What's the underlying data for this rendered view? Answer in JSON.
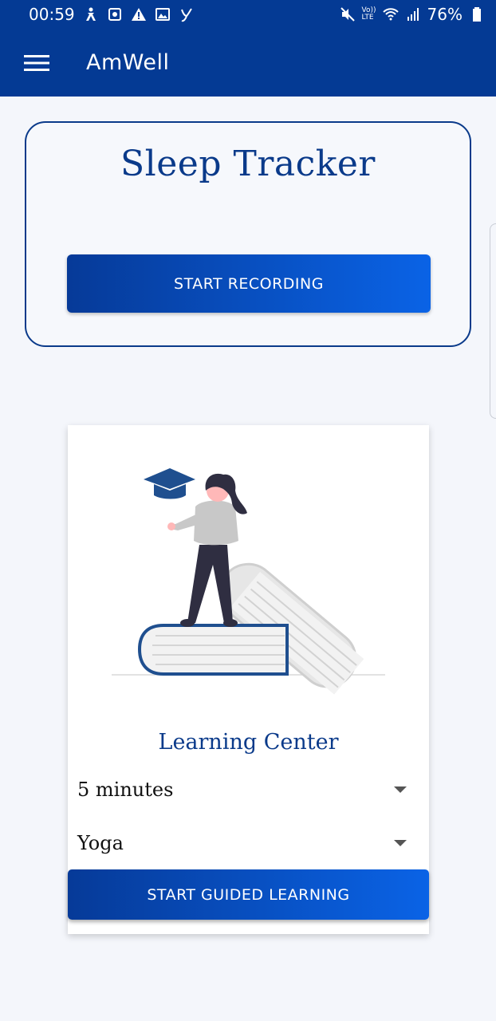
{
  "status_bar": {
    "time": "00:59",
    "battery": "76%",
    "lte_label_top": "Vo))",
    "lte_label_bottom": "LTE"
  },
  "app_bar": {
    "title": "AmWell",
    "menu_icon": "hamburger-menu-icon"
  },
  "sleep_tracker": {
    "title": "Sleep Tracker",
    "button_label": "START RECORDING"
  },
  "learning_center": {
    "title": "Learning Center",
    "duration_selected": "5 minutes",
    "activity_selected": "Yoga",
    "button_label": "START GUIDED LEARNING"
  },
  "colors": {
    "primary": "#043a94",
    "accent": "#0a63e6",
    "heading": "#0a3a8a"
  }
}
